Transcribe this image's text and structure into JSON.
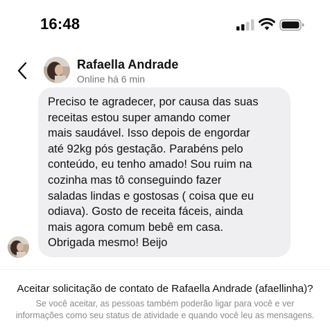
{
  "status_bar": {
    "time": "16:48"
  },
  "header": {
    "contact_name": "Rafaella Andrade",
    "contact_status": "Online há 6 min"
  },
  "message": {
    "text": "Preciso te agradecer, por causa das suas\nreceitas estou super amando comer\nmais saudável. Isso depois de engordar\naté 92kg pós gestação. Parabéns pelo\nconteúdo, eu tenho amado! Sou ruim na\ncozinha mas tô conseguindo fazer\nsaladas lindas e gostosas ( coisa que eu\nodiava). Gosto de receita fáceis, ainda\nmais agora comum bebê em casa.\nObrigada mesmo! Beijo"
  },
  "contact_request": {
    "title": "Aceitar solicitação de contato de Rafaella Andrade (afaellinha)?",
    "description": "Se você aceitar, as pessoas também poderão ligar para você e ver informações como seu status de atividade e quando você leu as mensagens."
  },
  "icons": {
    "back": "chevron-left-icon",
    "signal": "cellular-signal-icon",
    "wifi": "wifi-icon",
    "battery": "battery-icon"
  }
}
